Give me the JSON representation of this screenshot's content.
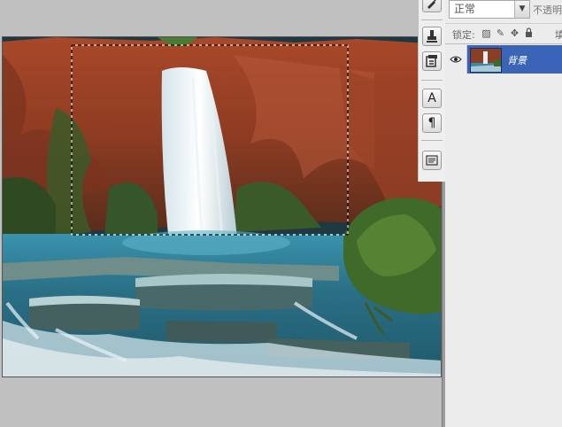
{
  "layers_panel": {
    "blend_mode": "正常",
    "opacity_label": "不透明",
    "lock_label": "锁定:",
    "fill_label": "填",
    "layers": [
      {
        "name": "背景",
        "visible": true,
        "selected": true
      }
    ]
  },
  "toolstrip": {
    "tools": [
      "brush-tool",
      "clone-stamp-tool",
      "history-brush-tool",
      "character-panel",
      "paragraph-panel",
      "layer-comps-panel"
    ]
  },
  "canvas": {
    "image_subject": "waterfall",
    "has_marquee_selection": true
  }
}
